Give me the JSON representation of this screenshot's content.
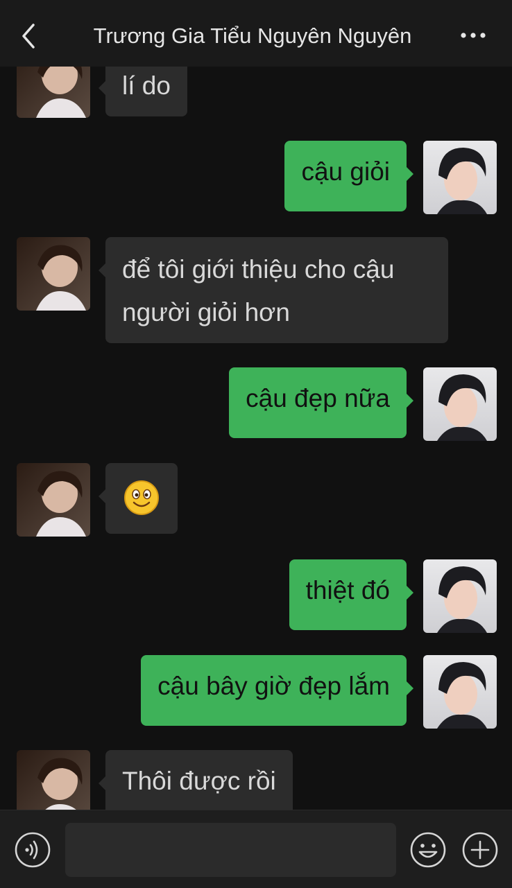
{
  "header": {
    "title": "Trương Gia Tiểu Nguyên Nguyên",
    "back_icon": "chevron-left-icon",
    "more_icon": "more-horizontal-icon"
  },
  "messages": [
    {
      "side": "in",
      "text": "lí do"
    },
    {
      "side": "out",
      "text": "cậu giỏi"
    },
    {
      "side": "in",
      "text": "để tôi giới thiệu cho cậu người giỏi hơn"
    },
    {
      "side": "out",
      "text": "cậu đẹp nữa"
    },
    {
      "side": "in",
      "emoji": "smiling-face-emoji"
    },
    {
      "side": "out",
      "text": "thiệt đó"
    },
    {
      "side": "out",
      "text": "cậu bây giờ đẹp lắm"
    },
    {
      "side": "in",
      "text": "Thôi được rồi"
    }
  ],
  "input": {
    "value": "",
    "placeholder": ""
  },
  "footer": {
    "voice_icon": "voice-icon",
    "emoji_icon": "emoji-icon",
    "plus_icon": "plus-circle-icon"
  },
  "colors": {
    "background": "#111111",
    "outgoing_bubble": "#3eb259",
    "incoming_bubble": "#2c2c2c",
    "text_light": "#d9d9d9"
  }
}
